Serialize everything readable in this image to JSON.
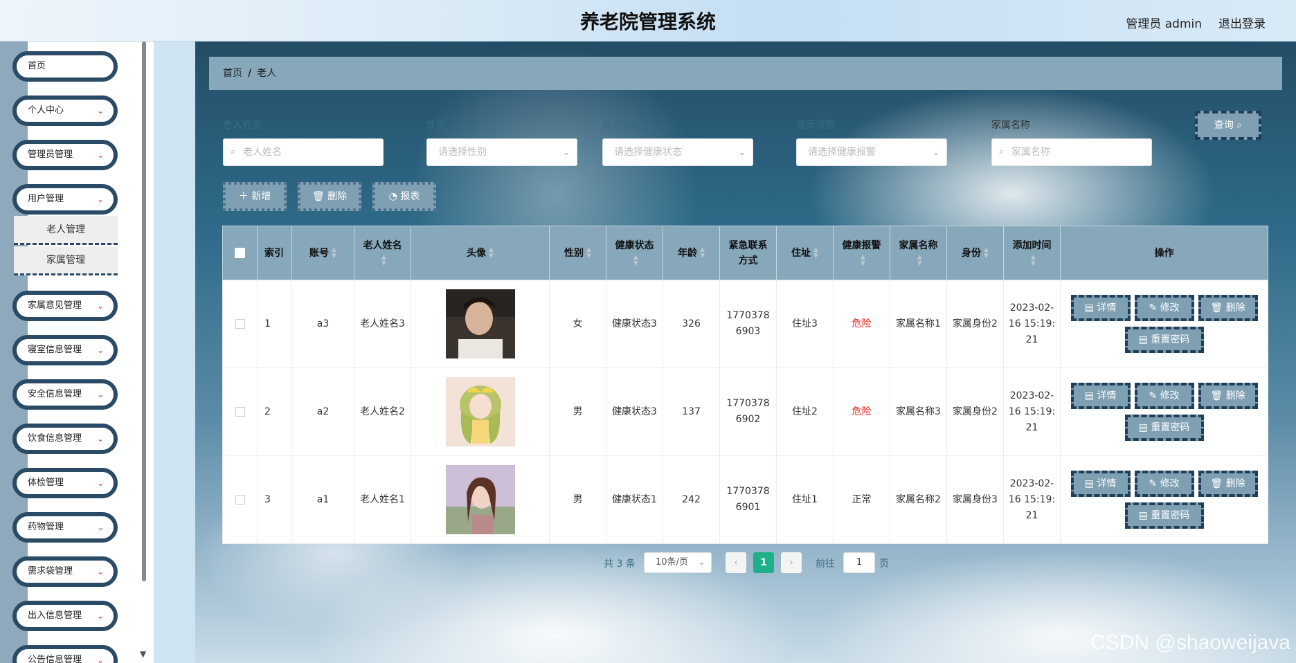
{
  "header": {
    "title": "养老院管理系统",
    "user": "管理员 admin",
    "logout": "退出登录"
  },
  "sidebar": {
    "items": [
      {
        "label": "首页",
        "expandable": false
      },
      {
        "label": "个人中心",
        "expandable": true
      },
      {
        "label": "管理员管理",
        "expandable": true
      },
      {
        "label": "用户管理",
        "expandable": true
      },
      {
        "label": "家属意见管理",
        "expandable": true
      },
      {
        "label": "寝室信息管理",
        "expandable": true
      },
      {
        "label": "安全信息管理",
        "expandable": true
      },
      {
        "label": "饮食信息管理",
        "expandable": true
      },
      {
        "label": "体检管理",
        "expandable": true
      },
      {
        "label": "药物管理",
        "expandable": true
      },
      {
        "label": "需求袋管理",
        "expandable": true
      },
      {
        "label": "出入信息管理",
        "expandable": true
      },
      {
        "label": "公告信息管理",
        "expandable": true
      }
    ],
    "sub_items": [
      "老人管理",
      "家属管理"
    ]
  },
  "breadcrumb": {
    "home": "首页",
    "sep": "/",
    "current": "老人"
  },
  "filters": [
    {
      "label": "老人姓名",
      "placeholder": "老人姓名",
      "type": "search"
    },
    {
      "label": "性别",
      "placeholder": "请选择性别",
      "type": "select"
    },
    {
      "label": "健康状态",
      "placeholder": "请选择健康状态",
      "type": "select"
    },
    {
      "label": "健康报警",
      "placeholder": "请选择健康报警",
      "type": "select"
    },
    {
      "label": "家属名称",
      "placeholder": "家属名称",
      "type": "search"
    }
  ],
  "query_button": "查询",
  "actions": {
    "add": "新增",
    "delete": "删除",
    "report": "报表"
  },
  "table": {
    "headers": [
      "索引",
      "账号",
      "老人姓名",
      "头像",
      "性别",
      "健康状态",
      "年龄",
      "紧急联系方式",
      "住址",
      "健康报警",
      "家属名称",
      "身份",
      "添加时间",
      "操作"
    ],
    "rows": [
      {
        "index": "1",
        "account": "a3",
        "name": "老人姓名3",
        "gender": "女",
        "health": "健康状态3",
        "age": "326",
        "phone": "17703786903",
        "address": "住址3",
        "alarm": "危险",
        "alarm_level": "danger",
        "family": "家属名称1",
        "identity": "家属身份2",
        "time": "2023-02-16 15:19:21",
        "avatar": "young-man-photo"
      },
      {
        "index": "2",
        "account": "a2",
        "name": "老人姓名2",
        "gender": "男",
        "health": "健康状态3",
        "age": "137",
        "phone": "17703786902",
        "address": "住址2",
        "alarm": "危险",
        "alarm_level": "danger",
        "family": "家属名称3",
        "identity": "家属身份2",
        "time": "2023-02-16 15:19:21",
        "avatar": "anime-girl-illustration"
      },
      {
        "index": "3",
        "account": "a1",
        "name": "老人姓名1",
        "gender": "男",
        "health": "健康状态1",
        "age": "242",
        "phone": "17703786901",
        "address": "住址1",
        "alarm": "正常",
        "alarm_level": "normal",
        "family": "家属名称2",
        "identity": "家属身份3",
        "time": "2023-02-16 15:19:21",
        "avatar": "woman-in-flowers-photo"
      }
    ],
    "op_buttons": {
      "detail": "详情",
      "edit": "修改",
      "delete": "删除",
      "reset": "重置密码"
    }
  },
  "pagination": {
    "total": "共 3 条",
    "page_size": "10条/页",
    "current_page": "1",
    "goto_prefix": "前往",
    "goto_value": "1",
    "goto_suffix": "页"
  },
  "watermark": "CSDN @shaoweijava",
  "colors": {
    "accent": "#87a7ba",
    "button": "#7f9fb3",
    "border_dark": "#1f3e5a",
    "danger": "#e0201a",
    "page_active": "#1fb089"
  }
}
